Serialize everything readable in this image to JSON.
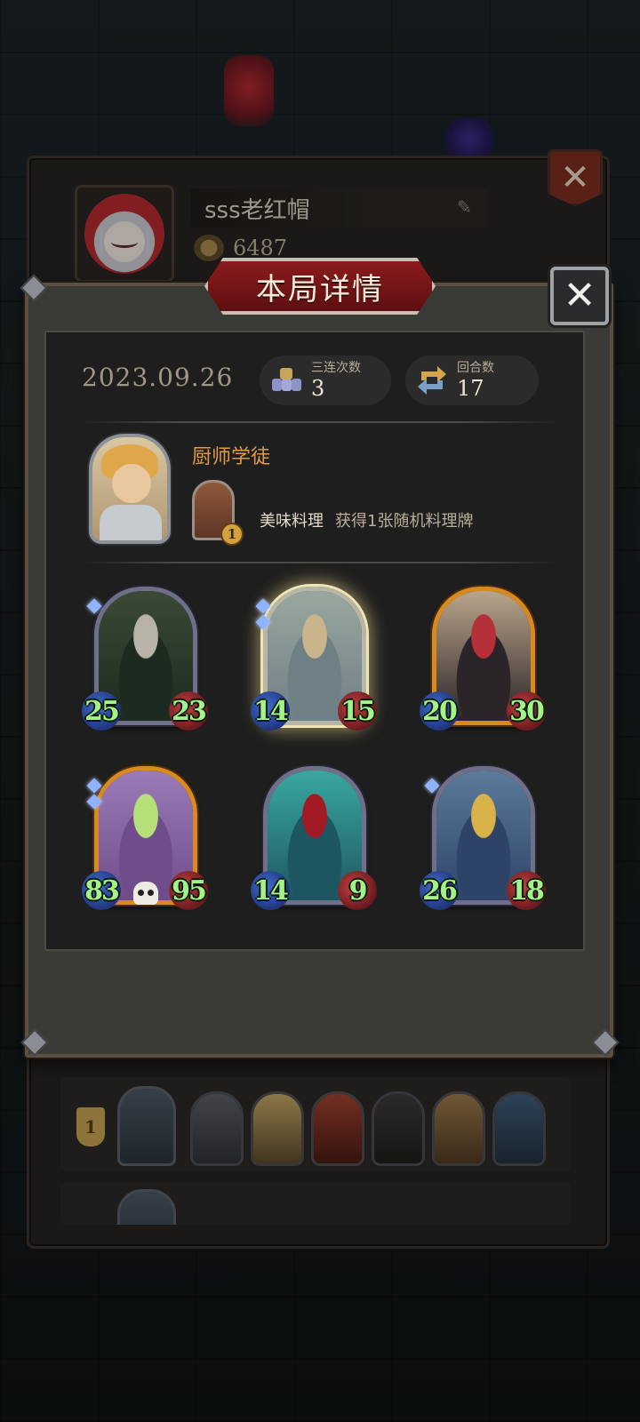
{
  "profile": {
    "name": "sss老红帽",
    "coins": "6487"
  },
  "dialog": {
    "title": "本局详情",
    "date": "2023.09.26",
    "stats": [
      {
        "label": "三连次数",
        "value": "3",
        "icon": "triple-cards-icon"
      },
      {
        "label": "回合数",
        "value": "17",
        "icon": "refresh-arrows-icon"
      }
    ],
    "hero": {
      "name": "厨师学徒",
      "skill_name": "美味料理",
      "skill_desc": "获得1张随机料理牌",
      "skill_level": "1"
    },
    "units": [
      {
        "atk": "25",
        "hp": "23",
        "frame": "silver",
        "gems": 1,
        "art_colors": [
          "#3b4a35",
          "#1c2a20",
          "#b7b3a6"
        ]
      },
      {
        "atk": "14",
        "hp": "15",
        "frame": "silver-highlight",
        "gems": 2,
        "art_colors": [
          "#9aa7a0",
          "#6e7f86",
          "#c9b48c"
        ]
      },
      {
        "atk": "20",
        "hp": "30",
        "frame": "gold",
        "gems": 0,
        "art_colors": [
          "#b9a58b",
          "#2b2428",
          "#b6303a"
        ]
      },
      {
        "atk": "83",
        "hp": "95",
        "frame": "gold",
        "gems": 2,
        "art_colors": [
          "#9a7bb7",
          "#6f4d8a",
          "#b6e07a"
        ],
        "skull": true
      },
      {
        "atk": "14",
        "hp": "9",
        "frame": "silver",
        "gems": 0,
        "art_colors": [
          "#3aa7a0",
          "#1d5660",
          "#a11a24"
        ]
      },
      {
        "atk": "26",
        "hp": "18",
        "frame": "silver",
        "gems": 1,
        "art_colors": [
          "#5c7a9a",
          "#2d4468",
          "#d9b24a"
        ]
      }
    ]
  },
  "leaderboard": {
    "rows": [
      {
        "rank": "1"
      }
    ]
  },
  "colors": {
    "title_banner": "#7a1619",
    "hero_name": "#e29a40",
    "stat_number": "#a3f28a"
  }
}
